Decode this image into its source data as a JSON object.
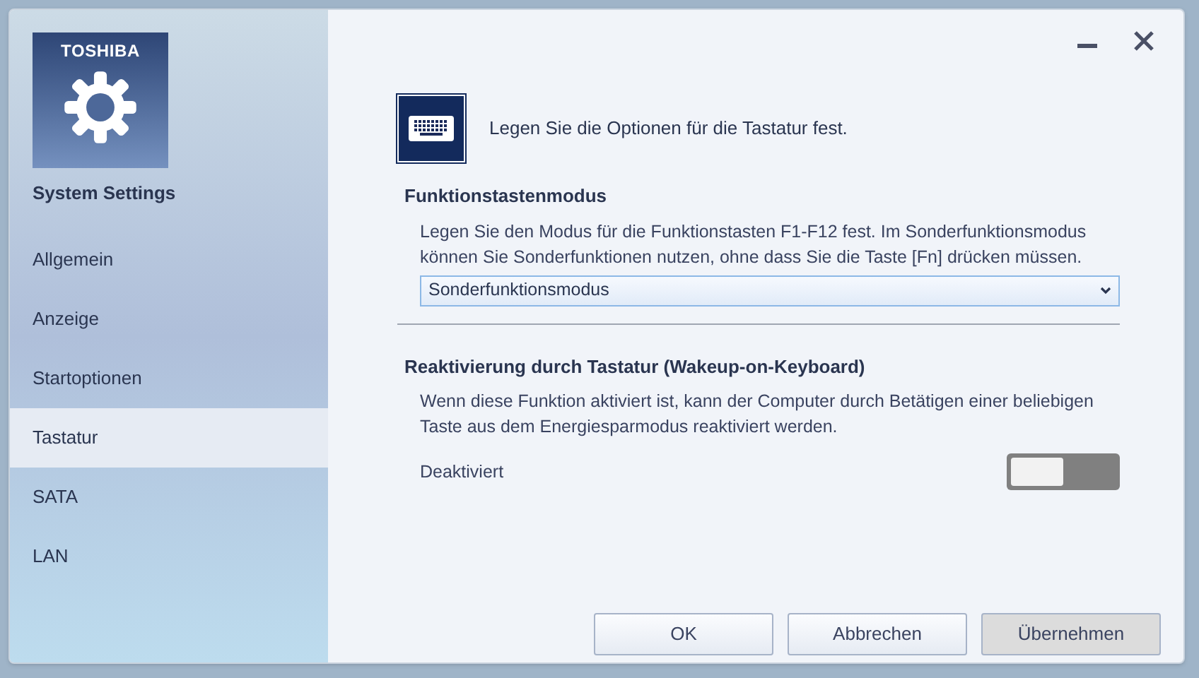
{
  "sidebar": {
    "brand": "TOSHIBA",
    "title": "System Settings",
    "items": [
      {
        "label": "Allgemein",
        "selected": false
      },
      {
        "label": "Anzeige",
        "selected": false
      },
      {
        "label": "Startoptionen",
        "selected": false
      },
      {
        "label": "Tastatur",
        "selected": true
      },
      {
        "label": "SATA",
        "selected": false
      },
      {
        "label": "LAN",
        "selected": false
      }
    ]
  },
  "page": {
    "intro": "Legen Sie die Optionen für die Tastatur fest.",
    "sections": [
      {
        "kind": "select",
        "heading": "Funktionstastenmodus",
        "description": "Legen Sie den Modus für die Funktionstasten F1-F12 fest. Im Sonderfunktionsmodus können Sie Sonderfunktionen nutzen, ohne dass Sie die Taste [Fn] drücken müssen.",
        "value": "Sonderfunktionsmodus"
      },
      {
        "kind": "toggle",
        "heading": "Reaktivierung durch Tastatur (Wakeup-on-Keyboard)",
        "description": "Wenn diese Funktion aktiviert ist, kann der Computer durch Betätigen einer beliebigen Taste aus dem Energiesparmodus reaktiviert werden.",
        "state_label": "Deaktiviert",
        "on": false
      }
    ]
  },
  "buttons": [
    {
      "label": "OK",
      "disabled": false
    },
    {
      "label": "Abbrechen",
      "disabled": false
    },
    {
      "label": "Übernehmen",
      "disabled": true
    }
  ]
}
